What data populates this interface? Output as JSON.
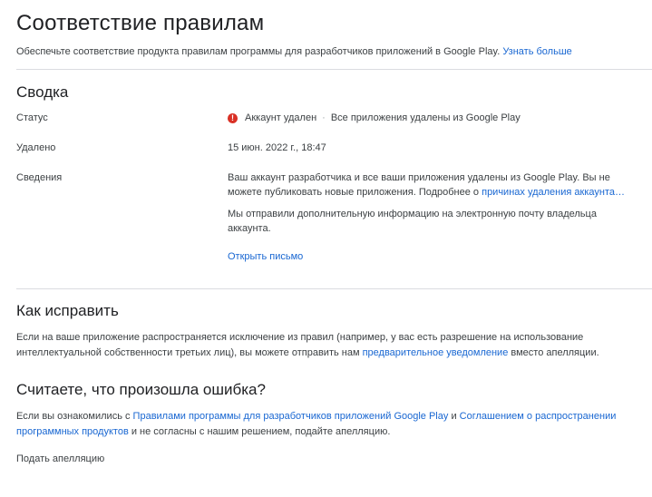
{
  "header": {
    "title": "Соответствие правилам",
    "subtitle": "Обеспечьте соответствие продукта правилам программы для разработчиков приложений в Google Play.",
    "learn_more": "Узнать больше"
  },
  "summary": {
    "title": "Сводка",
    "status_label": "Статус",
    "status_value": "Аккаунт удален",
    "status_separator": "·",
    "status_detail": "Все приложения удалены из Google Play",
    "removed_label": "Удалено",
    "removed_value": "15 июн. 2022 г., 18:47",
    "details_label": "Сведения",
    "details_text_1": "Ваш аккаунт разработчика и все ваши приложения удалены из Google Play. Вы не можете публиковать новые приложения. Подробнее о",
    "details_link": "причинах удаления аккаунта…",
    "details_text_2": "Мы отправили дополнительную информацию на электронную почту владельца аккаунта.",
    "open_letter": "Открыть письмо",
    "status_icon_name": "error-icon",
    "status_color": "#d93025"
  },
  "fix": {
    "title": "Как исправить",
    "text_1": "Если на ваше приложение распространяется исключение из правил (например, у вас есть разрешение на использование интеллектуальной собственности третьих лиц), вы можете отправить нам",
    "link": "предварительное уведомление",
    "text_2": "вместо апелляции."
  },
  "mistake": {
    "title": "Считаете, что произошла ошибка?",
    "text_1": "Если вы ознакомились с",
    "link_1": "Правилами программы для разработчиков приложений Google Play",
    "text_2": "и",
    "link_2": "Соглашением о распространении программных продуктов",
    "text_3": "и не согласны с нашим решением, подайте апелляцию.",
    "appeal": "Подать апелляцию"
  }
}
